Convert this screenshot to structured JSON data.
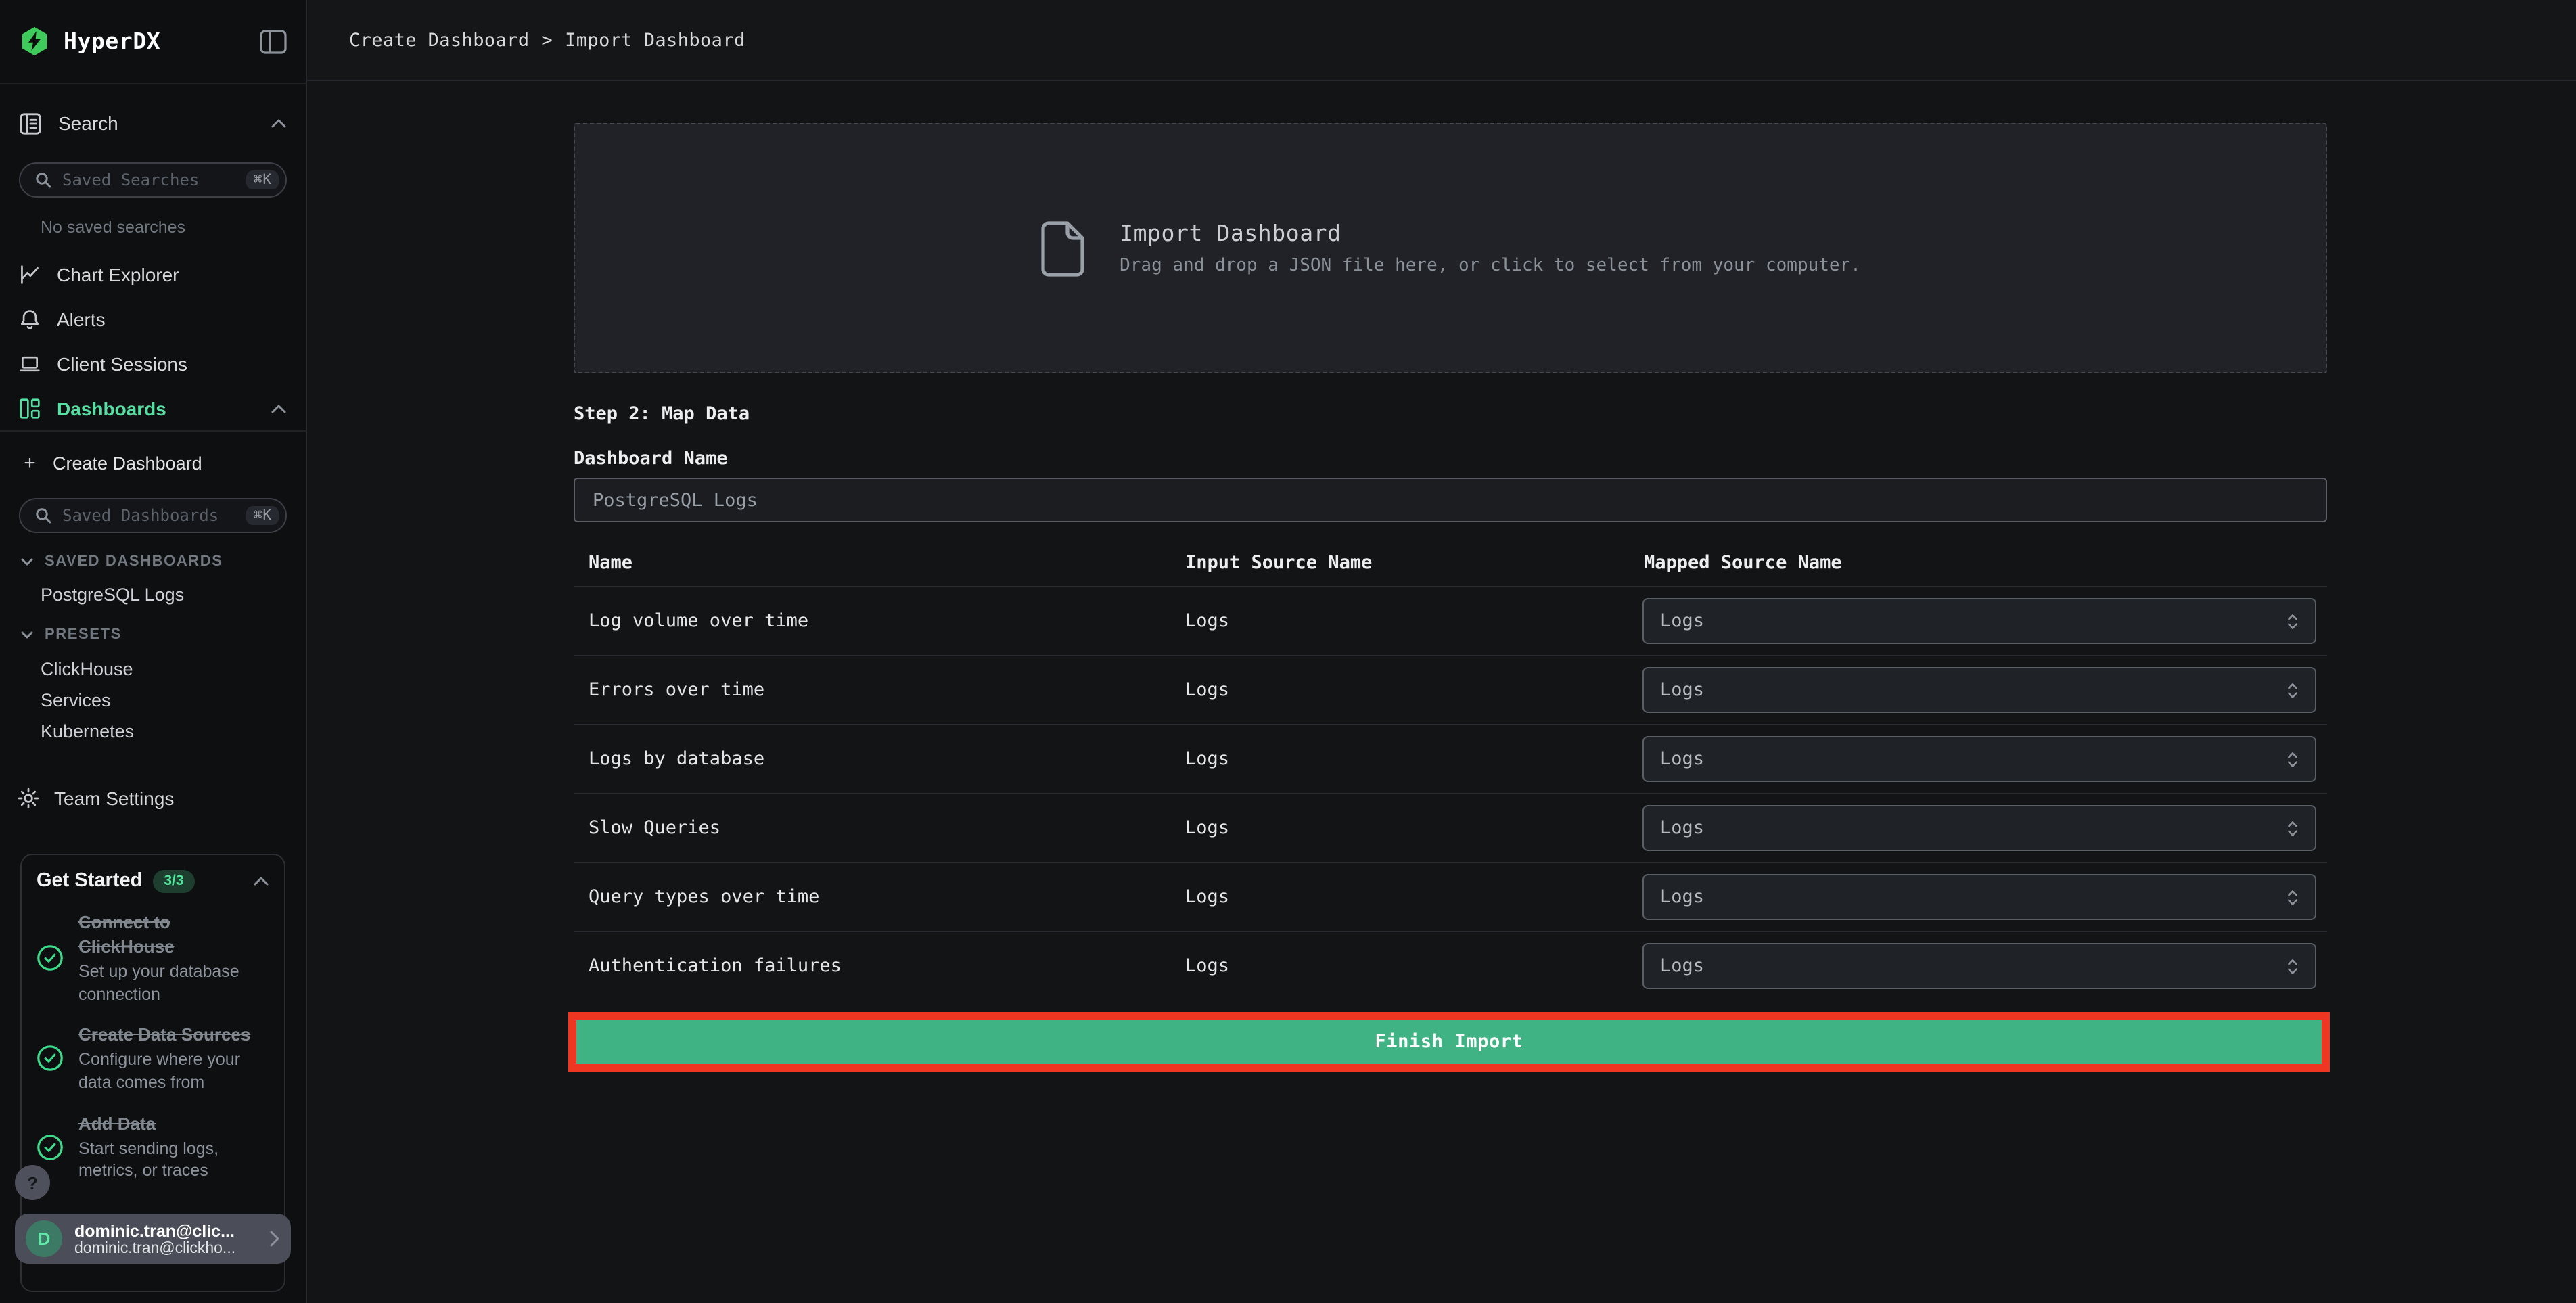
{
  "app": {
    "name": "HyperDX"
  },
  "colors": {
    "accent_green": "#56dfa2",
    "button_green": "#3fb383",
    "annotation_red": "#ee3621",
    "logo_green": "#3ecb5b",
    "badge_bg": "#1e3f2f",
    "badge_text": "#52e39c",
    "check_green": "#3bdc8c"
  },
  "sidebar": {
    "search_section": {
      "label": "Search",
      "input_placeholder": "Saved Searches",
      "shortcut": "⌘K",
      "empty_text": "No saved searches"
    },
    "nav": [
      {
        "label": "Chart Explorer"
      },
      {
        "label": "Alerts"
      },
      {
        "label": "Client Sessions"
      },
      {
        "label": "Dashboards"
      }
    ],
    "create_dashboard": {
      "plus": "+",
      "label": "Create Dashboard"
    },
    "dashboards_search": {
      "placeholder": "Saved Dashboards",
      "shortcut": "⌘K"
    },
    "saved_dashboards": {
      "header": "SAVED DASHBOARDS",
      "items": [
        "PostgreSQL Logs"
      ]
    },
    "presets": {
      "header": "PRESETS",
      "items": [
        "ClickHouse",
        "Services",
        "Kubernetes"
      ]
    },
    "team_settings_label": "Team Settings",
    "get_started": {
      "title": "Get Started",
      "badge": "3/3",
      "items": [
        {
          "title": "Connect to ClickHouse",
          "description": "Set up your database connection"
        },
        {
          "title": "Create Data Sources",
          "description": "Configure where your data comes from"
        },
        {
          "title": "Add Data",
          "description": "Start sending logs, metrics, or traces"
        }
      ]
    },
    "help_label": "?",
    "user": {
      "initial": "D",
      "name": "dominic.tran@clic...",
      "email": "dominic.tran@clickho..."
    }
  },
  "header": {
    "breadcrumb_parts": [
      "Create Dashboard",
      "Import Dashboard"
    ],
    "separator": ">"
  },
  "main": {
    "dropzone": {
      "title": "Import Dashboard",
      "subtitle": "Drag and drop a JSON file here, or click to select from your computer."
    },
    "step_label": "Step 2: Map Data",
    "dashboard_name_label": "Dashboard Name",
    "dashboard_name_value": "PostgreSQL Logs",
    "table": {
      "columns": [
        "Name",
        "Input Source Name",
        "Mapped Source Name"
      ],
      "rows": [
        {
          "name": "Log volume over time",
          "input_source": "Logs",
          "mapped_source": "Logs"
        },
        {
          "name": "Errors over time",
          "input_source": "Logs",
          "mapped_source": "Logs"
        },
        {
          "name": "Logs by database",
          "input_source": "Logs",
          "mapped_source": "Logs"
        },
        {
          "name": "Slow Queries",
          "input_source": "Logs",
          "mapped_source": "Logs"
        },
        {
          "name": "Query types over time",
          "input_source": "Logs",
          "mapped_source": "Logs"
        },
        {
          "name": "Authentication failures",
          "input_source": "Logs",
          "mapped_source": "Logs"
        }
      ]
    },
    "finish_button_label": "Finish Import"
  }
}
